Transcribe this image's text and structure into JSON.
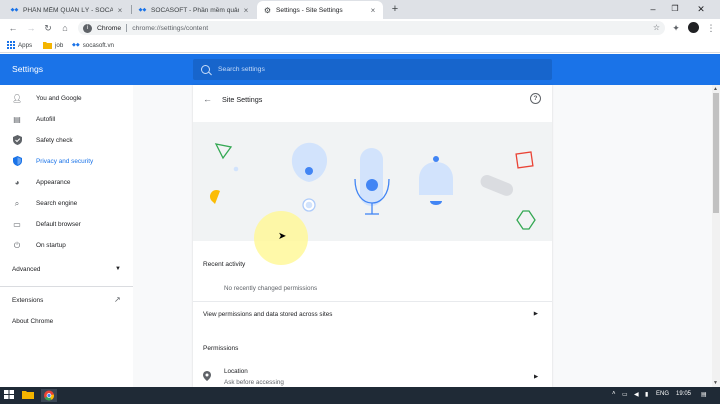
{
  "browser": {
    "tabs": [
      {
        "title": "PHẦN MỀM QUẢN LÝ - SOCASO",
        "favicon": "S",
        "active": false
      },
      {
        "title": "SOCASOFT - Phần mềm quản lý",
        "favicon": "S",
        "active": false
      },
      {
        "title": "Settings - Site Settings",
        "favicon": "gear-icon",
        "active": true
      }
    ],
    "omnibox": {
      "scheme": "Chrome",
      "url": "chrome://settings/content"
    },
    "bookmarks": [
      {
        "label": "Apps",
        "icon": "apps-grid-icon"
      },
      {
        "label": "job",
        "icon": "folder-icon"
      },
      {
        "label": "socasoft.vn",
        "icon": "site-favicon"
      }
    ]
  },
  "settings": {
    "title": "Settings",
    "search_placeholder": "Search settings",
    "sidebar": {
      "items": [
        {
          "label": "You and Google",
          "icon": "person-icon"
        },
        {
          "label": "Autofill",
          "icon": "clipboard-icon"
        },
        {
          "label": "Safety check",
          "icon": "shield-check-icon"
        },
        {
          "label": "Privacy and security",
          "icon": "shield-icon",
          "active": true
        },
        {
          "label": "Appearance",
          "icon": "palette-icon"
        },
        {
          "label": "Search engine",
          "icon": "search-icon"
        },
        {
          "label": "Default browser",
          "icon": "browser-icon"
        },
        {
          "label": "On startup",
          "icon": "power-icon"
        }
      ],
      "advanced_label": "Advanced",
      "extensions_label": "Extensions",
      "about_label": "About Chrome"
    },
    "page": {
      "title": "Site Settings",
      "recent_activity_heading": "Recent activity",
      "no_changes_text": "No recently changed permissions",
      "view_permissions_label": "View permissions and data stored across sites",
      "permissions_heading": "Permissions",
      "location": {
        "title": "Location",
        "subtitle": "Ask before accessing"
      }
    }
  },
  "taskbar": {
    "language": "ENG",
    "time": "19:05"
  },
  "colors": {
    "accent": "#1a73e8",
    "header_bg": "#1a73e8",
    "search_bg": "#1765cc",
    "taskbar_bg": "#1f2a36"
  }
}
